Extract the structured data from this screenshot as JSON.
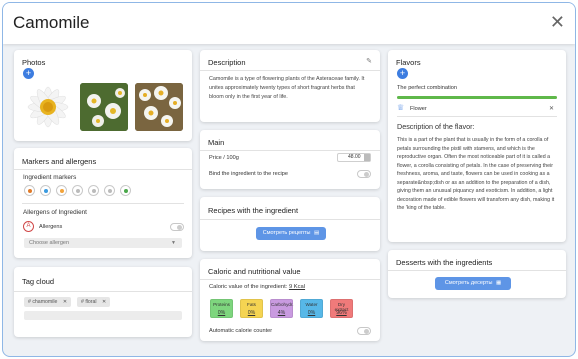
{
  "header": {
    "title": "Camomile"
  },
  "photos": {
    "title": "Photos"
  },
  "markers": {
    "title": "Markers and allergens",
    "ingredient_markers": "Ingredient markers",
    "allergens_heading": "Allergens of Ingredient",
    "allergens_label": "Allergens",
    "allergen_badge": "A",
    "select_placeholder": "Choose allergen"
  },
  "tags": {
    "title": "Tag cloud",
    "items": [
      "# chamomile",
      "# floral"
    ]
  },
  "description": {
    "title": "Description",
    "text": "Camomile is a type of flowering plants of the Asteraceae family. It unites approximately twenty types of short fragrant herbs that bloom only in the first year of life."
  },
  "main": {
    "title": "Main",
    "price_label": "Price / 100g",
    "price_value": "48.00",
    "bind_label": "Bind the ingredient to the recipe"
  },
  "recipes": {
    "title": "Recipes with the ingredient",
    "button": "Смотреть рецепты"
  },
  "caloric": {
    "title": "Caloric and nutritional value",
    "value_label": "Caloric value of the ingredient:",
    "value": "9 Kcal",
    "nutrients": [
      {
        "label": "Proteins",
        "value": "0%",
        "color": "#7ed67e"
      },
      {
        "label": "Fats",
        "value": "0%",
        "color": "#f5d452"
      },
      {
        "label": "Carbohydr.",
        "value": "4%",
        "color": "#c99ae0"
      },
      {
        "label": "Water",
        "value": "0%",
        "color": "#57b8e8"
      },
      {
        "label": "Dry extract",
        "value": "96%",
        "color": "#f07a7a"
      }
    ],
    "auto_label": "Automatic calorie counter"
  },
  "flavors": {
    "title": "Flavors",
    "subtitle": "The perfect combination",
    "progress": 1.0,
    "accent": "#5fb84a",
    "flower_label": "Flower",
    "desc_title": "Description of the flavor:",
    "desc_text": "This is a part of the plant that is usually in the form of a corolla of petals surrounding the pistil with stamens, and which is the reproductive organ. Often the most noticeable part of it is called a flower, a corolla consisting of petals. In the case of preserving their freshness, aroma, and taste, flowers can be used in cooking as a separate&nbsp;dish or as an addition to the preparation of a dish, giving them an unusual piquancy and exoticism. In addition, a light decoration made of edible flowers will transform any dish, making it the 'king of the table."
  },
  "desserts": {
    "title": "Desserts with the ingredients",
    "button": "Смотреть десерты"
  },
  "icons": {
    "close": "close-icon",
    "add": "plus-icon",
    "edit": "pencil-icon",
    "crown": "crown-icon",
    "document": "document-icon",
    "cake": "cake-icon"
  }
}
